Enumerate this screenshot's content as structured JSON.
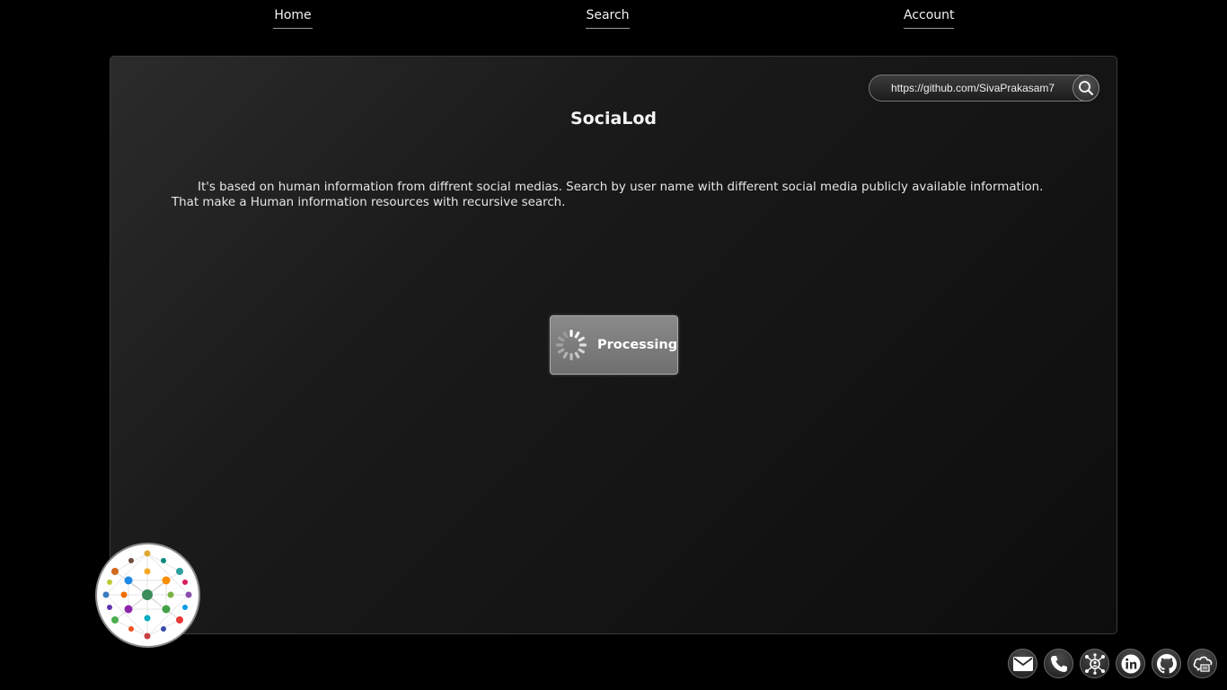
{
  "nav": {
    "home_label": "Home",
    "search_label": "Search",
    "account_label": "Account"
  },
  "search": {
    "value": "https://github.com/SivaPrakasam7",
    "icon": "search-icon"
  },
  "main": {
    "title": "SociaLod",
    "description": "It's based on human information from diffrent social medias. Search by user name with different social media publicly available information. That make a Human information resources with recursive search."
  },
  "status": {
    "label": "Processing",
    "icon": "spinner-icon"
  },
  "logo": {
    "icon": "social-network-logo"
  },
  "social": {
    "icons": [
      "mail-icon",
      "phone-icon",
      "network-icon",
      "linkedin-icon",
      "github-icon",
      "cloud-icon"
    ]
  },
  "colors": {
    "background": "#000000",
    "panel": "#1a1a1a",
    "text": "#eeeeee",
    "processing_bg": "#7d7d7d"
  }
}
